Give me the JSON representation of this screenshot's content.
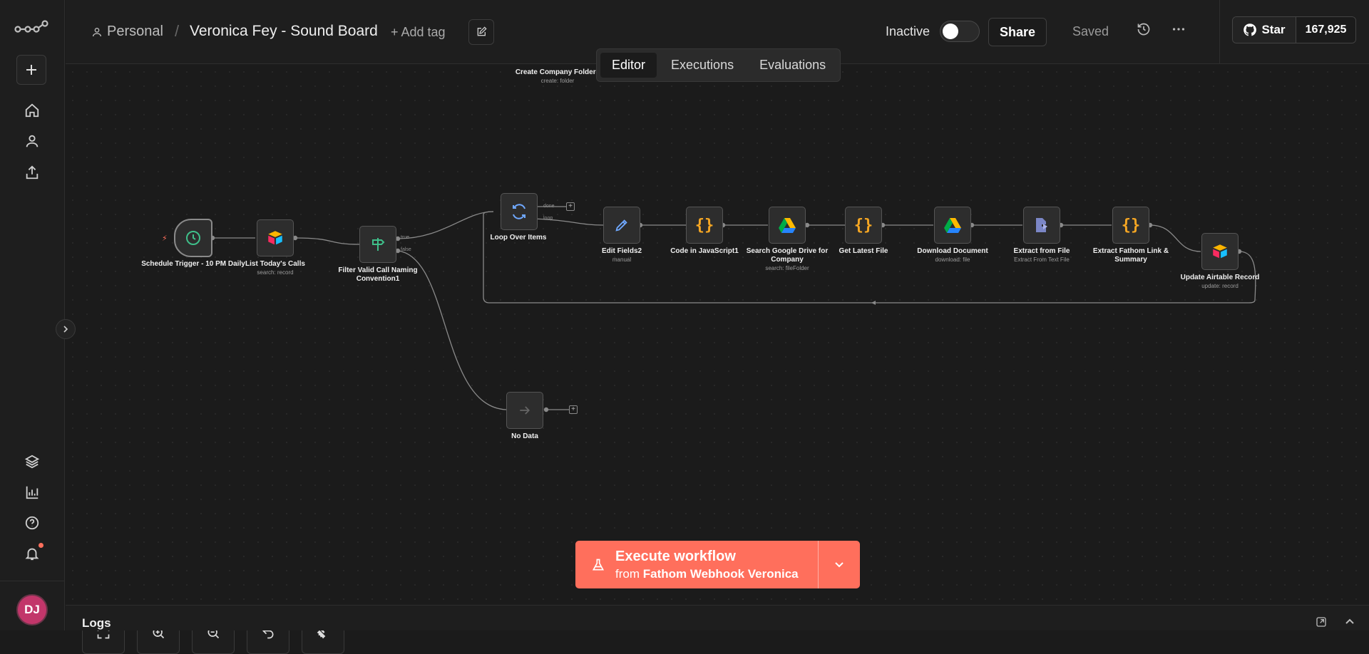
{
  "header": {
    "project": "Personal",
    "separator": "/",
    "workflow_title": "Veronica Fey - Sound Board",
    "add_tag": "+ Add tag",
    "status_label": "Inactive",
    "share_label": "Share",
    "saved_label": "Saved",
    "github_star_label": "Star",
    "github_star_count": "167,925"
  },
  "tabs": [
    {
      "label": "Editor",
      "active": true
    },
    {
      "label": "Executions",
      "active": false
    },
    {
      "label": "Evaluations",
      "active": false
    }
  ],
  "nodes": {
    "create_company_folder": {
      "label": "Create Company Folder4",
      "sub": "create: folder"
    },
    "schedule_trigger": {
      "label": "Schedule Trigger - 10 PM Daily",
      "icon": "clock-icon"
    },
    "list_calls": {
      "label": "List Today's Calls",
      "sub": "search: record",
      "icon": "airtable-icon"
    },
    "filter": {
      "label": "Filter Valid Call Naming Convention1",
      "icon": "signpost-icon",
      "port_true": "true",
      "port_false": "false"
    },
    "loop": {
      "label": "Loop Over Items",
      "icon": "loop-icon",
      "port_done": "done",
      "port_loop": "loop"
    },
    "edit_fields": {
      "label": "Edit Fields2",
      "sub": "manual",
      "icon": "pencil-icon"
    },
    "code_js": {
      "label": "Code in JavaScript1",
      "icon": "code-braces-icon"
    },
    "search_drive": {
      "label": "Search Google Drive for Company",
      "sub": "search: fileFolder",
      "icon": "google-drive-icon"
    },
    "latest_file": {
      "label": "Get Latest File",
      "icon": "code-braces-icon"
    },
    "download_doc": {
      "label": "Download Document",
      "sub": "download: file",
      "icon": "google-drive-icon"
    },
    "extract_file": {
      "label": "Extract from File",
      "sub": "Extract From Text File",
      "icon": "file-extract-icon"
    },
    "extract_fathom": {
      "label": "Extract Fathom Link & Summary",
      "icon": "code-braces-icon"
    },
    "update_airtable": {
      "label": "Update Airtable Record",
      "sub": "update: record",
      "icon": "airtable-icon"
    },
    "no_data": {
      "label": "No Data",
      "icon": "arrow-right-icon"
    }
  },
  "execute": {
    "title": "Execute workflow",
    "from_prefix": "from",
    "from_target": "Fathom Webhook Veronica"
  },
  "logs": {
    "title": "Logs"
  },
  "avatar": {
    "initials": "DJ",
    "color": "#c2366a"
  },
  "colors": {
    "accent": "#ff6f5c",
    "code": "#f5a623",
    "trigger": "#3fbf8a"
  }
}
